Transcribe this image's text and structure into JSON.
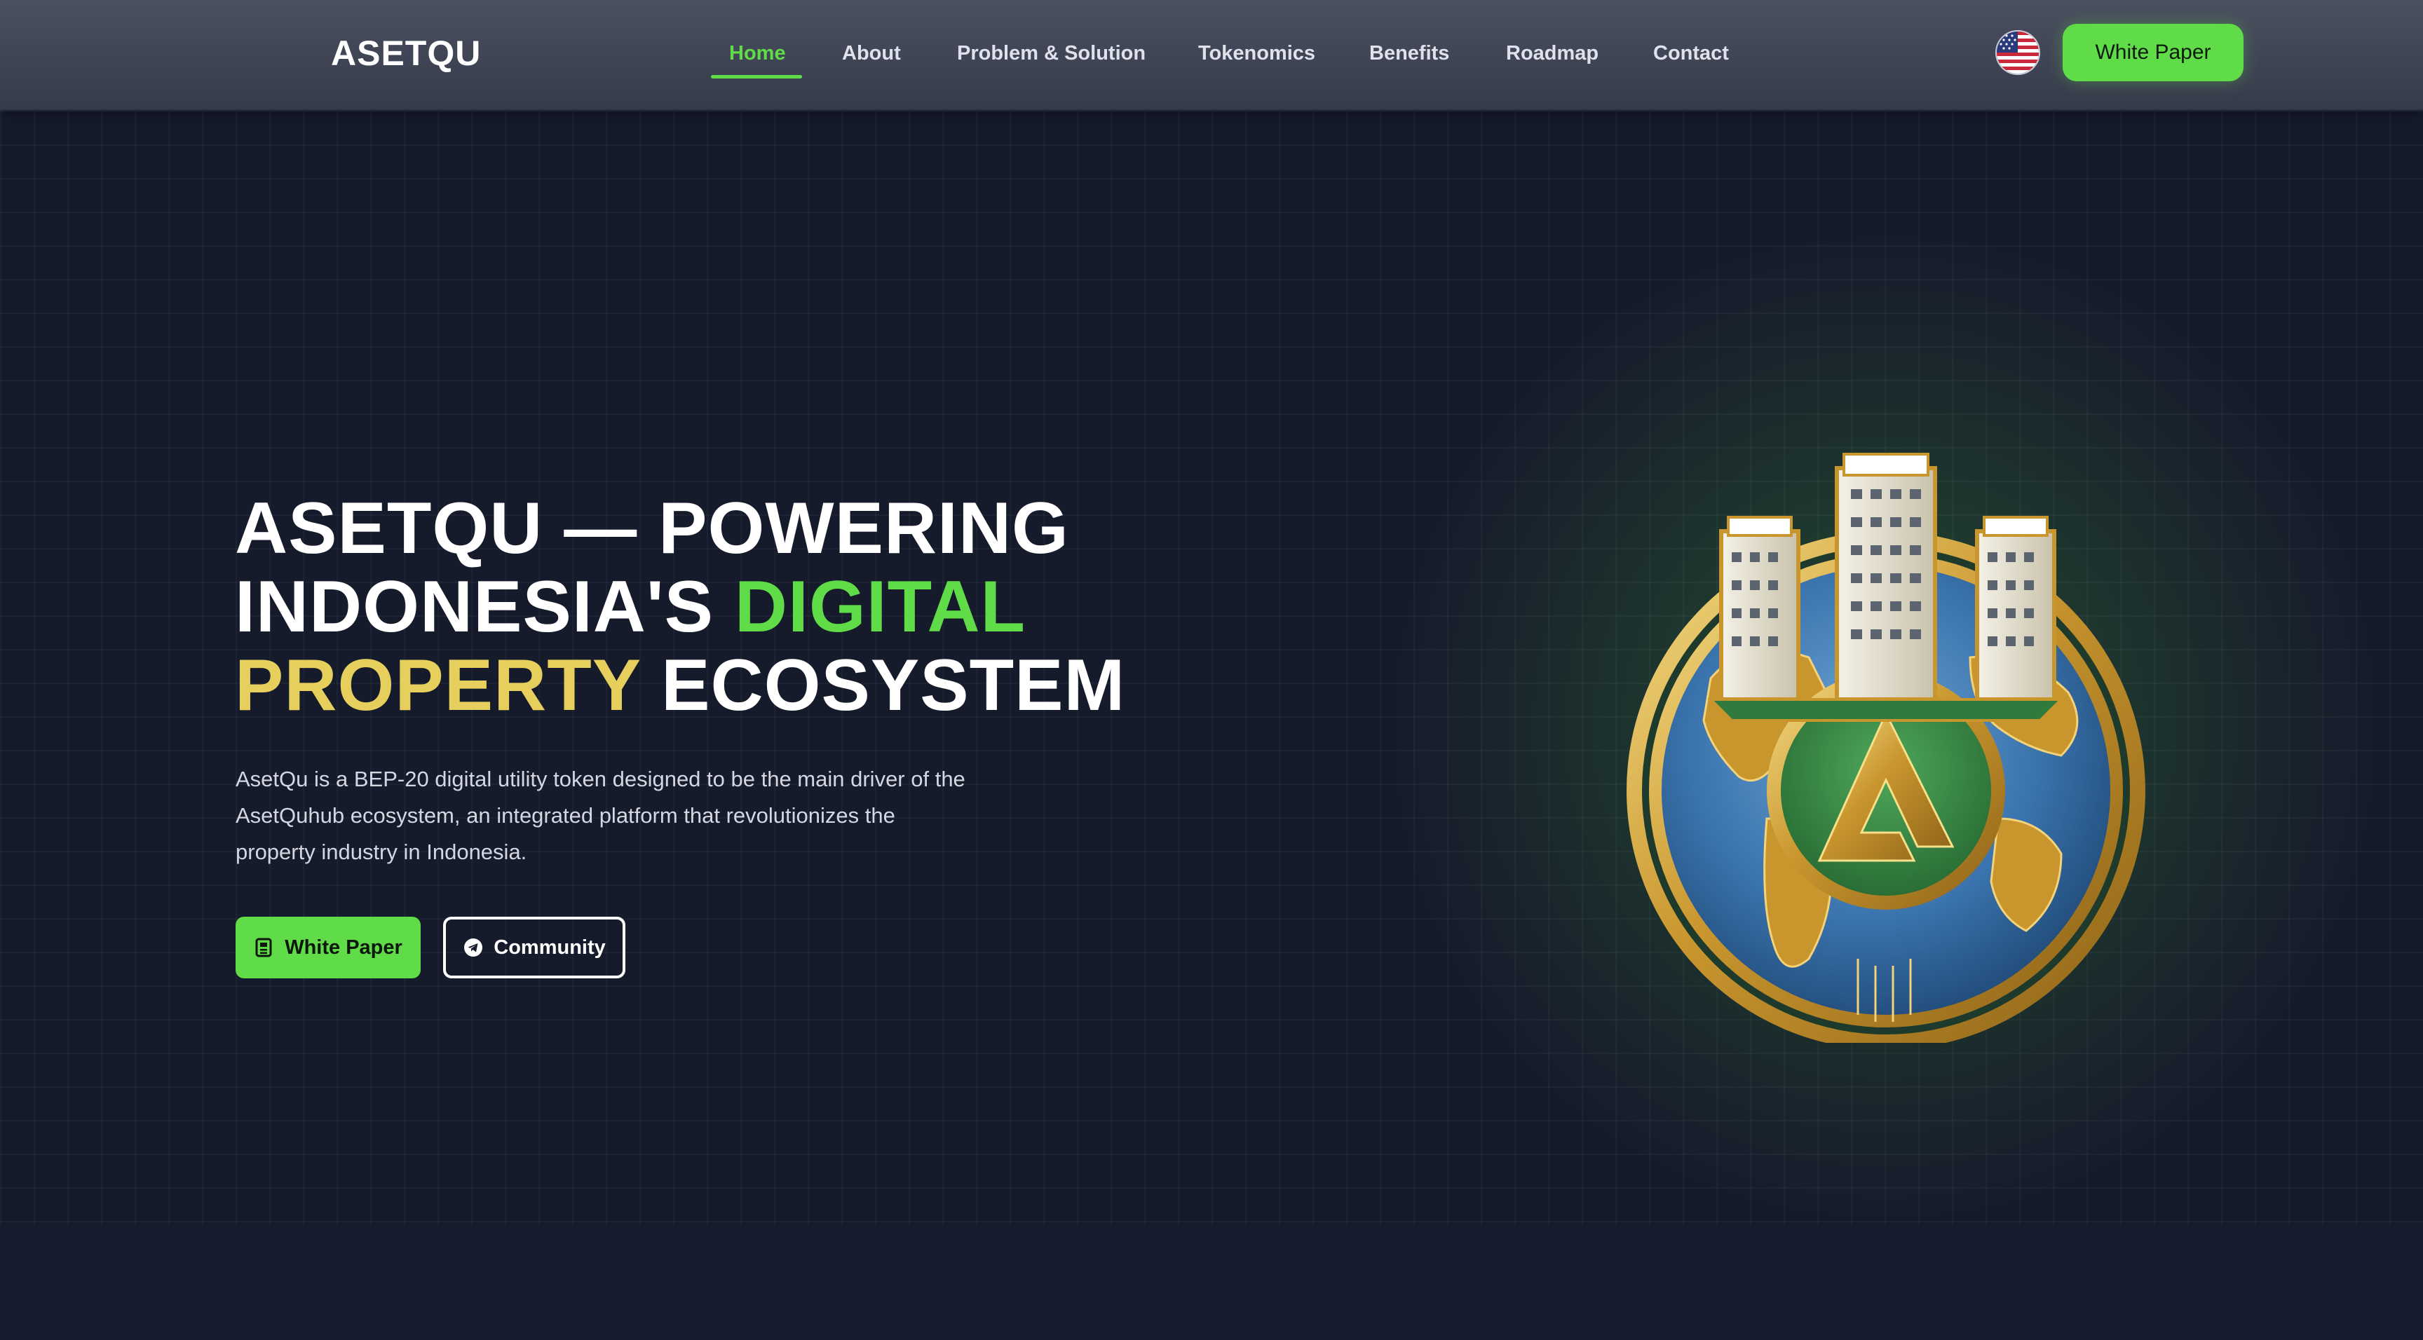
{
  "brand": "ASETQU",
  "nav": {
    "links": [
      "Home",
      "About",
      "Problem & Solution",
      "Tokenomics",
      "Benefits",
      "Roadmap",
      "Contact"
    ],
    "active": "Home",
    "language_icon": "us-flag-icon",
    "cta_label": "White Paper"
  },
  "hero": {
    "title_line1": "ASETQU — POWERING",
    "title_line2_a": "INDONESIA'S",
    "title_line2_b": "DIGITAL",
    "title_line3_a": "PROPERTY",
    "title_line3_b": "ECOSYSTEM",
    "description": "AsetQu is a BEP-20 digital utility token designed to be the main driver of the AsetQuhub ecosystem, an integrated platform that revolutionizes the property industry in Indonesia.",
    "primary_button": {
      "label": "White Paper",
      "icon": "document-icon"
    },
    "secondary_button": {
      "label": "Community",
      "icon": "telegram-icon"
    },
    "image": "asetqu-globe-coin-illustration"
  },
  "colors": {
    "accent_green": "#5fdc48",
    "accent_gold": "#e7cf5e",
    "background": "#161b2c",
    "nav_background": "#454a5a"
  }
}
